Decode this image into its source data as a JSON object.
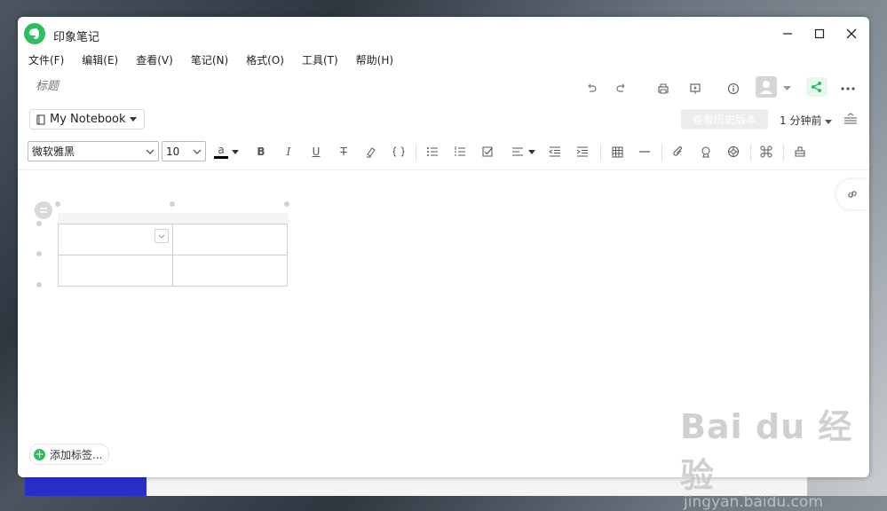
{
  "window": {
    "title": "印象笔记"
  },
  "menu": [
    "文件(F)",
    "编辑(E)",
    "查看(V)",
    "笔记(N)",
    "格式(O)",
    "工具(T)",
    "帮助(H)"
  ],
  "note": {
    "title_placeholder": "标题"
  },
  "notebook": {
    "name": "My Notebook"
  },
  "history": {
    "button_label": "查看历史版本",
    "time": "1 分钟前"
  },
  "format": {
    "font": "微软雅黑",
    "size": "10",
    "font_color_glyph": "a"
  },
  "tags": {
    "add_label": "添加标签..."
  },
  "watermark": {
    "main": "Bai du 经验",
    "sub": "jingyan.baidu.com"
  },
  "colors": {
    "accent": "#2dbe60",
    "history_button": "#ececec"
  }
}
